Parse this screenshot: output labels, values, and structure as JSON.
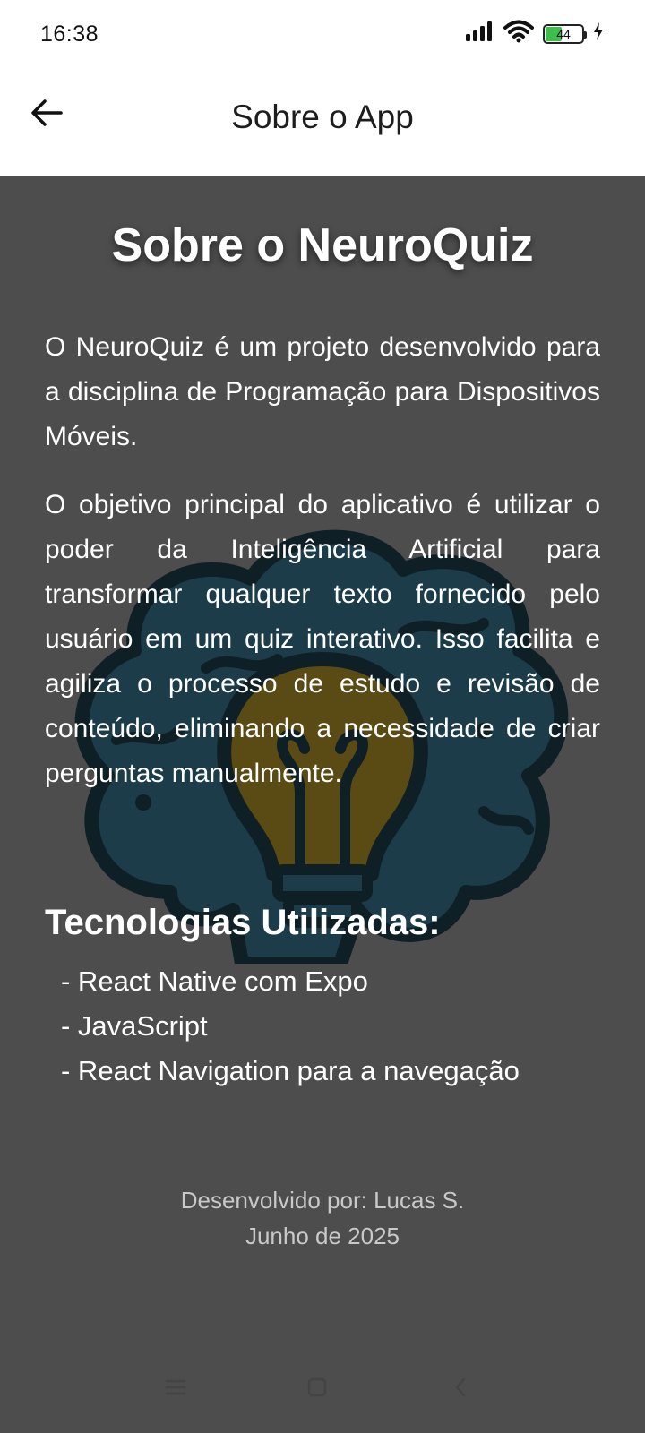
{
  "status_bar": {
    "time": "16:38",
    "battery_level": "44"
  },
  "app_bar": {
    "title": "Sobre o App"
  },
  "content": {
    "heading": "Sobre o NeuroQuiz",
    "paragraph1": "O NeuroQuiz é um projeto desenvolvido para a disciplina de Programação para Dispositivos Móveis.",
    "paragraph2": "O objetivo principal do aplicativo é utilizar o poder da Inteligência Artificial para transformar qualquer texto fornecido pelo usuário em um quiz interativo. Isso facilita e agiliza o processo de estudo e revisão de conteúdo, eliminando a necessidade de criar perguntas manualmente.",
    "tech_heading": "Tecnologias Utilizadas:",
    "technologies": [
      "- React Native com Expo",
      "- JavaScript",
      "- React Navigation para a navegação"
    ],
    "footer_line1": "Desenvolvido por: Lucas S.",
    "footer_line2": "Junho de 2025"
  },
  "icons": {
    "back": "arrow-left-icon",
    "logo": "brain-lightbulb-icon",
    "nav_menu": "menu-icon",
    "nav_home": "square-icon",
    "nav_back": "chevron-left-icon"
  },
  "colors": {
    "background": "#4d4d4d",
    "brain": "#1b3c48",
    "bulb": "#5a4a14",
    "battery": "#3fbe4d"
  }
}
